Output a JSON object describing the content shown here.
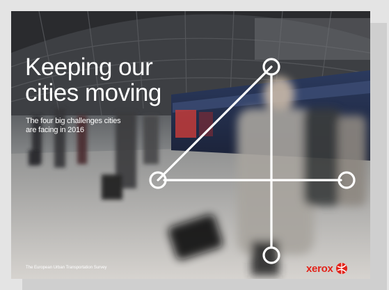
{
  "cover": {
    "title_line1": "Keeping our",
    "title_line2": "cities moving",
    "subtitle_line1": "The four big challenges cities",
    "subtitle_line2": "are facing in 2016",
    "survey_label": "The European Urban Transportation Survey",
    "logo_text": "xerox",
    "logo_icon": "xerox-ball-icon",
    "graphic_icon": "number-four-line-graphic",
    "colors": {
      "logo_red": "#e2231a",
      "graphic_white": "#ffffff"
    }
  }
}
